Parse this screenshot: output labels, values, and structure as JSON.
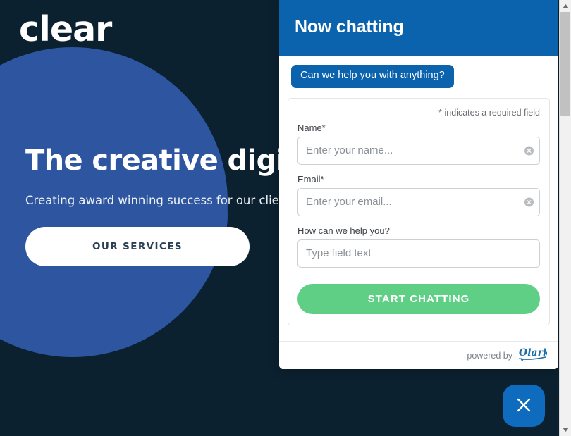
{
  "site": {
    "brand": "clear",
    "hero_title": "The creative digital agency",
    "hero_subtitle": "Creating award winning success for our clients",
    "cta_label": "OUR SERVICES",
    "bg_color": "#0b2130",
    "circle_color": "#2d55a0"
  },
  "chat": {
    "header_title": "Now chatting",
    "header_color": "#0b63ad",
    "operator_message": "Can we help you with anything?",
    "form": {
      "required_note": "* indicates a required field",
      "fields": [
        {
          "label": "Name*",
          "value": "",
          "placeholder": "Enter your name...",
          "has_clear": true
        },
        {
          "label": "Email*",
          "value": "",
          "placeholder": "Enter your email...",
          "has_clear": true
        },
        {
          "label": "How can we help you?",
          "value": "",
          "placeholder": "Type field text",
          "has_clear": false
        }
      ],
      "submit_label": "START CHATTING",
      "submit_color": "#5ecf85"
    },
    "footer": {
      "powered_by": "powered by",
      "vendor": "Olark"
    }
  },
  "close_button": {
    "icon": "close-icon",
    "color": "#0f6bbd"
  },
  "scrollbar": {
    "up_icon": "triangle-up-icon",
    "down_icon": "triangle-down-icon"
  }
}
